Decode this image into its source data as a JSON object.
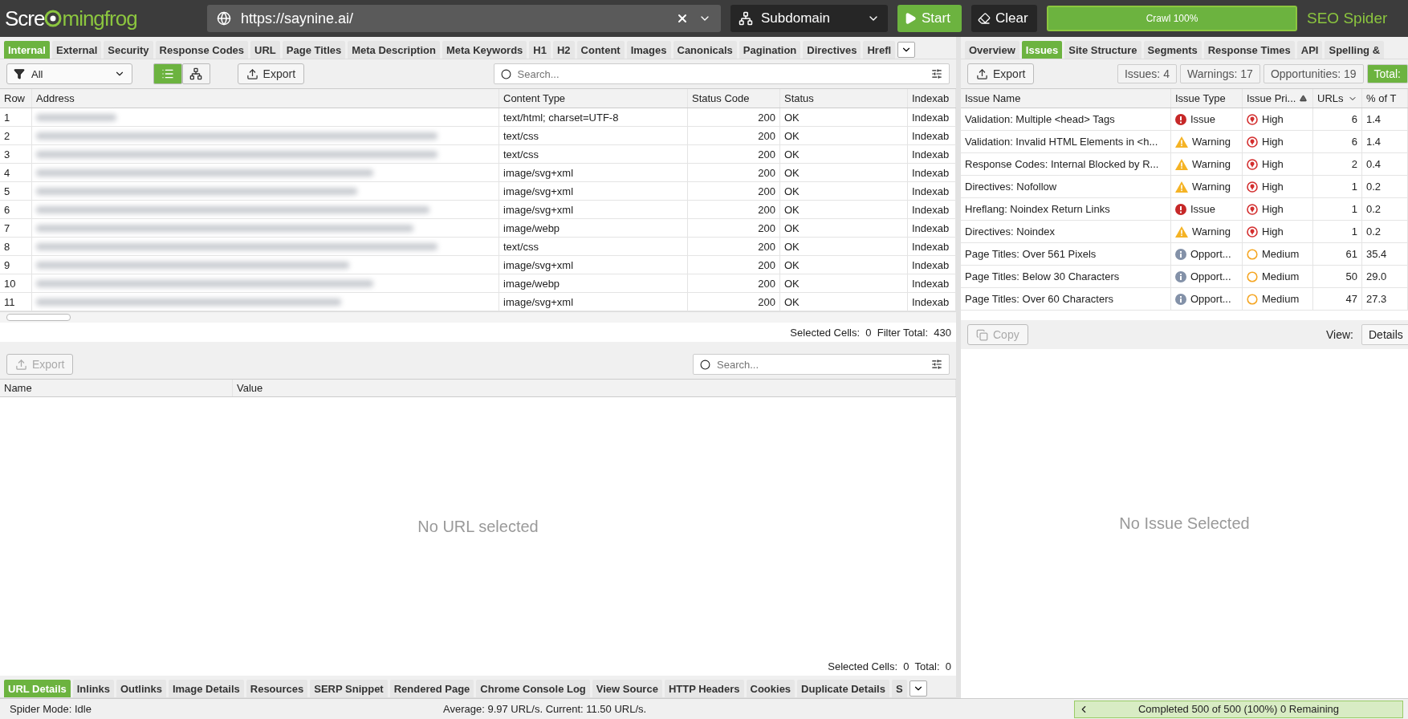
{
  "top_bar": {
    "logo": {
      "before": "Scre",
      "after": "mingfrog"
    },
    "url": "https://saynine.ai/",
    "mode": "Subdomain",
    "start": "Start",
    "clear": "Clear",
    "crawl": {
      "label": "Crawl 100%",
      "level": 1
    },
    "product": "SEO Spider"
  },
  "left_tabs": [
    {
      "label": "Internal",
      "selected": true
    },
    {
      "label": "External",
      "selected": false
    },
    {
      "label": "Security",
      "selected": false
    },
    {
      "label": "Response Codes",
      "selected": false
    },
    {
      "label": "URL",
      "selected": false
    },
    {
      "label": "Page Titles",
      "selected": false
    },
    {
      "label": "Meta Description",
      "selected": false
    },
    {
      "label": "Meta Keywords",
      "selected": false
    },
    {
      "label": "H1",
      "selected": false
    },
    {
      "label": "H2",
      "selected": false
    },
    {
      "label": "Content",
      "selected": false
    },
    {
      "label": "Images",
      "selected": false
    },
    {
      "label": "Canonicals",
      "selected": false
    },
    {
      "label": "Pagination",
      "selected": false
    },
    {
      "label": "Directives",
      "selected": false
    },
    {
      "label": "Hrefl",
      "selected": false
    }
  ],
  "left_toolbar": {
    "filter": "All",
    "views": [
      {
        "kind": "list",
        "selected": true
      },
      {
        "kind": "tree",
        "selected": false
      }
    ],
    "export": "Export",
    "search_placeholder": "Search..."
  },
  "url_table": {
    "columns": [
      "Row",
      "Address",
      "Content Type",
      "Status Code",
      "Status",
      "Indexab"
    ],
    "rows": [
      {
        "row": "1",
        "content_type": "text/html; charset=UTF-8",
        "status_code": "200",
        "status": "OK",
        "indexability": "Indexab"
      },
      {
        "row": "2",
        "content_type": "text/css",
        "status_code": "200",
        "status": "OK",
        "indexability": "Indexab"
      },
      {
        "row": "3",
        "content_type": "text/css",
        "status_code": "200",
        "status": "OK",
        "indexability": "Indexab"
      },
      {
        "row": "4",
        "content_type": "image/svg+xml",
        "status_code": "200",
        "status": "OK",
        "indexability": "Indexab"
      },
      {
        "row": "5",
        "content_type": "image/svg+xml",
        "status_code": "200",
        "status": "OK",
        "indexability": "Indexab"
      },
      {
        "row": "6",
        "content_type": "image/svg+xml",
        "status_code": "200",
        "status": "OK",
        "indexability": "Indexab"
      },
      {
        "row": "7",
        "content_type": "image/webp",
        "status_code": "200",
        "status": "OK",
        "indexability": "Indexab"
      },
      {
        "row": "8",
        "content_type": "text/css",
        "status_code": "200",
        "status": "OK",
        "indexability": "Indexab"
      },
      {
        "row": "9",
        "content_type": "image/svg+xml",
        "status_code": "200",
        "status": "OK",
        "indexability": "Indexab"
      },
      {
        "row": "10",
        "content_type": "image/webp",
        "status_code": "200",
        "status": "OK",
        "indexability": "Indexab"
      },
      {
        "row": "11",
        "content_type": "image/svg+xml",
        "status_code": "200",
        "status": "OK",
        "indexability": "Indexab"
      }
    ],
    "summary": "Selected Cells:  0  Filter Total:  430"
  },
  "details": {
    "export": "Export",
    "search_placeholder": "Search...",
    "columns": [
      "Name",
      "Value"
    ],
    "empty": "No URL selected",
    "summary": "Selected Cells:  0  Total:  0"
  },
  "bottom_tabs": [
    {
      "label": "URL Details",
      "selected": true
    },
    {
      "label": "Inlinks",
      "selected": false
    },
    {
      "label": "Outlinks",
      "selected": false
    },
    {
      "label": "Image Details",
      "selected": false
    },
    {
      "label": "Resources",
      "selected": false
    },
    {
      "label": "SERP Snippet",
      "selected": false
    },
    {
      "label": "Rendered Page",
      "selected": false
    },
    {
      "label": "Chrome Console Log",
      "selected": false
    },
    {
      "label": "View Source",
      "selected": false
    },
    {
      "label": "HTTP Headers",
      "selected": false
    },
    {
      "label": "Cookies",
      "selected": false
    },
    {
      "label": "Duplicate Details",
      "selected": false
    },
    {
      "label": "S",
      "selected": false
    }
  ],
  "right_tabs": [
    {
      "label": "Overview",
      "selected": false
    },
    {
      "label": "Issues",
      "selected": true
    },
    {
      "label": "Site Structure",
      "selected": false
    },
    {
      "label": "Segments",
      "selected": false
    },
    {
      "label": "Response Times",
      "selected": false
    },
    {
      "label": "API",
      "selected": false
    },
    {
      "label": "Spelling &",
      "selected": false
    }
  ],
  "right_toolbar": {
    "export": "Export",
    "filters": [
      {
        "label": "Issues: 4",
        "selected": false
      },
      {
        "label": "Warnings: 17",
        "selected": false
      },
      {
        "label": "Opportunities: 19",
        "selected": false
      },
      {
        "label": "Total:",
        "selected": true
      }
    ]
  },
  "issues_table": {
    "columns": [
      "Issue Name",
      "Issue Type",
      "Issue Pri...",
      "URLs",
      "% of T"
    ],
    "rows": [
      {
        "name": "Validation: Multiple <head> Tags",
        "type": {
          "kind": "issue",
          "label": "Issue"
        },
        "priority": {
          "kind": "high",
          "label": "High"
        },
        "urls": "6",
        "percent": "1.4"
      },
      {
        "name": "Validation: Invalid HTML Elements in <h...",
        "type": {
          "kind": "warning",
          "label": "Warning"
        },
        "priority": {
          "kind": "high",
          "label": "High"
        },
        "urls": "6",
        "percent": "1.4"
      },
      {
        "name": "Response Codes: Internal Blocked by R...",
        "type": {
          "kind": "warning",
          "label": "Warning"
        },
        "priority": {
          "kind": "high",
          "label": "High"
        },
        "urls": "2",
        "percent": "0.4"
      },
      {
        "name": "Directives: Nofollow",
        "type": {
          "kind": "warning",
          "label": "Warning"
        },
        "priority": {
          "kind": "high",
          "label": "High"
        },
        "urls": "1",
        "percent": "0.2"
      },
      {
        "name": "Hreflang: Noindex Return Links",
        "type": {
          "kind": "issue",
          "label": "Issue"
        },
        "priority": {
          "kind": "high",
          "label": "High"
        },
        "urls": "1",
        "percent": "0.2"
      },
      {
        "name": "Directives: Noindex",
        "type": {
          "kind": "warning",
          "label": "Warning"
        },
        "priority": {
          "kind": "high",
          "label": "High"
        },
        "urls": "1",
        "percent": "0.2"
      },
      {
        "name": "Page Titles: Over 561 Pixels",
        "type": {
          "kind": "opportunity",
          "label": "Opport..."
        },
        "priority": {
          "kind": "medium",
          "label": "Medium"
        },
        "urls": "61",
        "percent": "35.4"
      },
      {
        "name": "Page Titles: Below 30 Characters",
        "type": {
          "kind": "opportunity",
          "label": "Opport..."
        },
        "priority": {
          "kind": "medium",
          "label": "Medium"
        },
        "urls": "50",
        "percent": "29.0"
      },
      {
        "name": "Page Titles: Over 60 Characters",
        "type": {
          "kind": "opportunity",
          "label": "Opport..."
        },
        "priority": {
          "kind": "medium",
          "label": "Medium"
        },
        "urls": "47",
        "percent": "27.3"
      }
    ]
  },
  "issue_details": {
    "copy": "Copy",
    "view_label": "View:",
    "view": "Details",
    "empty": "No Issue Selected"
  },
  "status_bar": {
    "mode": "Spider Mode: Idle",
    "speed": "Average: 9.97 URL/s. Current: 11.50 URL/s.",
    "progress": {
      "label": "Completed 500 of 500 (100%) 0 Remaining",
      "level": 1
    }
  }
}
